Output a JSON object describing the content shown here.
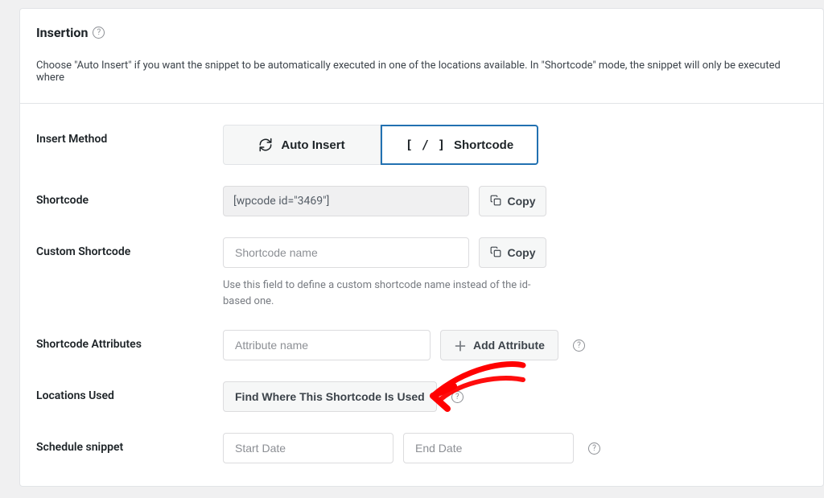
{
  "panel": {
    "title": "Insertion",
    "description": "Choose \"Auto Insert\" if you want the snippet to be automatically executed in one of the locations available. In \"Shortcode\" mode, the snippet will only be executed where"
  },
  "insert_method": {
    "label": "Insert Method",
    "auto_insert": "Auto Insert",
    "shortcode": "Shortcode"
  },
  "shortcode": {
    "label": "Shortcode",
    "value": "[wpcode id=\"3469\"]",
    "copy": "Copy"
  },
  "custom_shortcode": {
    "label": "Custom Shortcode",
    "placeholder": "Shortcode name",
    "copy": "Copy",
    "note": "Use this field to define a custom shortcode name instead of the id-based one."
  },
  "attributes": {
    "label": "Shortcode Attributes",
    "placeholder": "Attribute name",
    "add": "Add Attribute"
  },
  "locations": {
    "label": "Locations Used",
    "find": "Find Where This Shortcode Is Used"
  },
  "schedule": {
    "label": "Schedule snippet",
    "start_placeholder": "Start Date",
    "end_placeholder": "End Date"
  }
}
